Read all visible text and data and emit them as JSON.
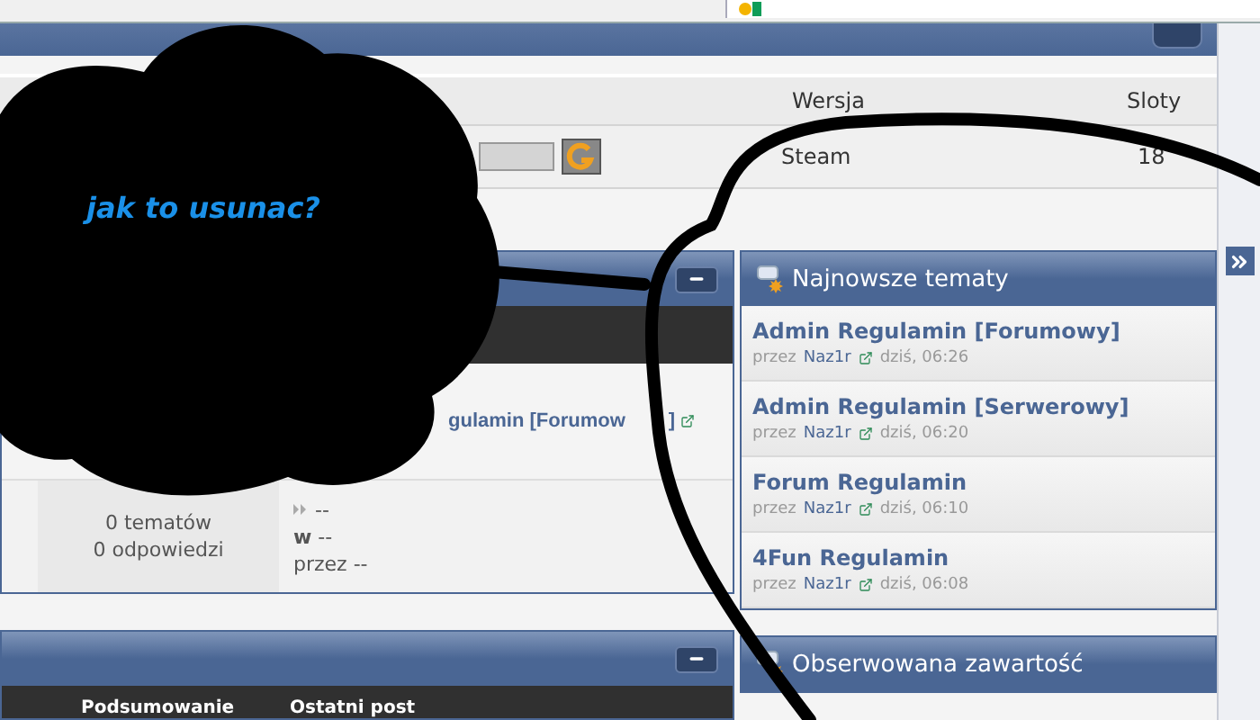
{
  "server_table": {
    "columns": [
      {
        "label": "Wersja"
      },
      {
        "label": "Sloty"
      }
    ],
    "row": {
      "version": "Steam",
      "slots": "18"
    }
  },
  "forum_panel": {
    "topic_link": "gulamin [Forumow",
    "topic_link_end": "]",
    "stats": [
      "0 tematów",
      "0 odpowiedzi"
    ],
    "last_post": {
      "title": "--",
      "in": "**w** --",
      "by": "przez --"
    }
  },
  "second_panel": {
    "columns": [
      "Podsumowanie",
      "Ostatni post"
    ]
  },
  "sidebar": {
    "latest": {
      "title": "Najnowsze tematy",
      "topics": [
        {
          "title": "Admin Regulamin [Forumowy]",
          "by": "przez",
          "author": "Naz1r",
          "time": "dziś, 06:26"
        },
        {
          "title": "Admin Regulamin [Serwerowy]",
          "by": "przez",
          "author": "Naz1r",
          "time": "dziś, 06:20"
        },
        {
          "title": "Forum Regulamin",
          "by": "przez",
          "author": "Naz1r",
          "time": "dziś, 06:10"
        },
        {
          "title": "4Fun Regulamin",
          "by": "przez",
          "author": "Naz1r",
          "time": "dziś, 06:08"
        }
      ]
    },
    "watched": {
      "title": "Obserwowana zawartość"
    }
  },
  "overlay": {
    "note": "jak to usunac?"
  }
}
